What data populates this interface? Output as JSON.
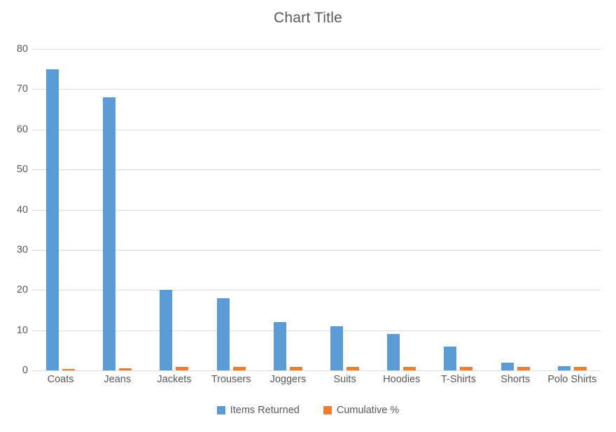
{
  "chart_data": {
    "type": "bar",
    "title": "Chart Title",
    "xlabel": "",
    "ylabel": "",
    "ylim": [
      0,
      80
    ],
    "ytick_step": 10,
    "yticks": [
      80,
      70,
      60,
      50,
      40,
      30,
      20,
      10,
      0
    ],
    "grid": true,
    "legend_position": "bottom",
    "categories": [
      "Coats",
      "Jeans",
      "Jackets",
      "Trousers",
      "Joggers",
      "Suits",
      "Hoodies",
      "T-Shirts",
      "Shorts",
      "Polo Shirts"
    ],
    "series": [
      {
        "name": "Items Returned",
        "color": "#5B9BD5",
        "values": [
          75,
          68,
          20,
          18,
          12,
          11,
          9,
          6,
          2,
          1
        ]
      },
      {
        "name": "Cumulative %",
        "color": "#ED7D31",
        "values": [
          0.3,
          0.6,
          0.8,
          0.8,
          0.8,
          0.95,
          0.95,
          0.95,
          0.95,
          0.95
        ]
      }
    ]
  },
  "style": {
    "text_color": "#595959",
    "gridline_color": "#d9d9d9",
    "background": "#ffffff"
  }
}
